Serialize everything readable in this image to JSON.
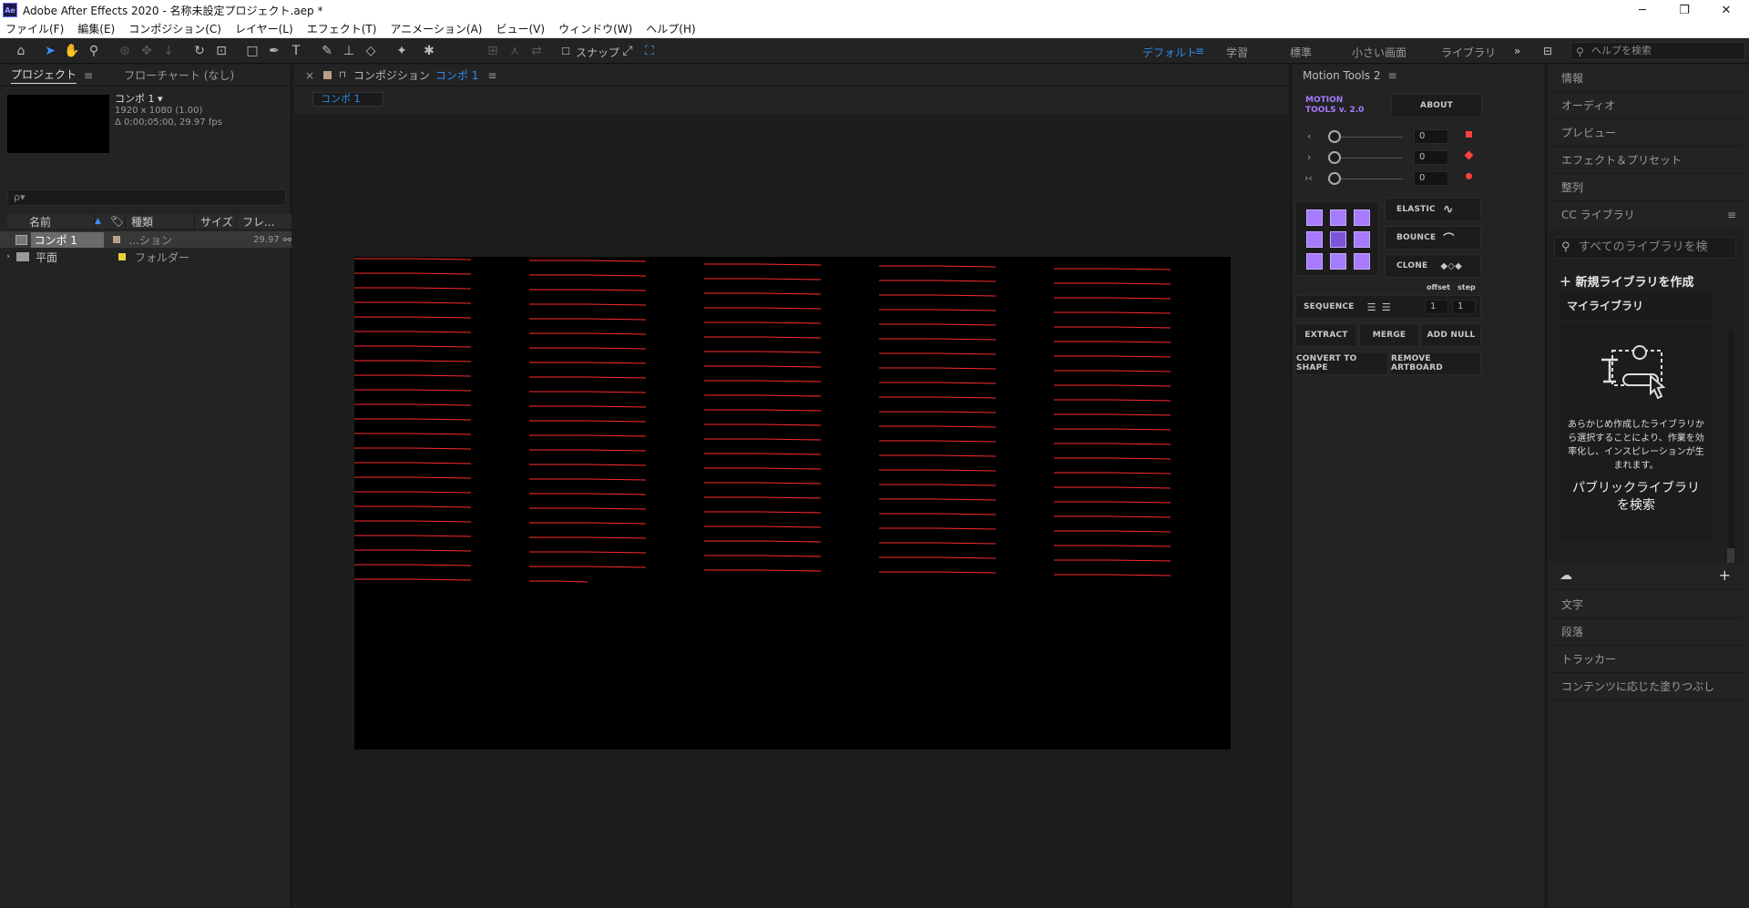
{
  "window": {
    "app_icon": "Ae",
    "title": "Adobe After Effects 2020 - 名称未設定プロジェクト.aep *",
    "controls": {
      "minimize": "─",
      "restore": "❐",
      "close": "✕"
    }
  },
  "menu": [
    "ファイル(F)",
    "編集(E)",
    "コンポジション(C)",
    "レイヤー(L)",
    "エフェクト(T)",
    "アニメーション(A)",
    "ビュー(V)",
    "ウィンドウ(W)",
    "ヘルプ(H)"
  ],
  "toolbar": {
    "snap_label": "スナップ",
    "workspaces": [
      "デフォルト",
      "学習",
      "標準",
      "小さい画面",
      "ライブラリ"
    ],
    "active_workspace": "デフォルト",
    "more": "»",
    "help_placeholder": "ヘルプを検索"
  },
  "project": {
    "tab": "プロジェクト",
    "tab2": "フローチャート (なし)",
    "item_name": "コンポ 1 ▾",
    "item_size": "1920 x 1080 (1.00)",
    "item_duration": "Δ 0;00;05;00, 29.97 fps",
    "search_icon": "ρ▾",
    "columns": [
      "名前",
      "種類",
      "サイズ",
      "フレ..."
    ],
    "rows": [
      {
        "name": "コンポ 1",
        "type": "...ション",
        "fps": "29.97",
        "label_color": "#b8a088"
      },
      {
        "name": "平面",
        "type": "フォルダー",
        "fps": "",
        "label_color": "#e8d23a"
      }
    ]
  },
  "composition": {
    "close": "×",
    "lock_icon": "🔒",
    "title_prefix": "コンポジション",
    "title_name": "コンポ 1",
    "layer_tab": "コンポ 1",
    "background": "#000000",
    "line_color": "#ff2b2b"
  },
  "motion_tools": {
    "panel_title": "Motion Tools 2",
    "logo_line1": "MOTION",
    "logo_line2": "TOOLS v. 2.0",
    "about": "ABOUT",
    "slider_values": [
      "0",
      "0",
      "0"
    ],
    "slider_icons": [
      "‹",
      "›",
      "›‹"
    ],
    "ease_buttons": [
      "ELASTIC",
      "BOUNCE",
      "CLONE"
    ],
    "offset_label": "offset",
    "step_label": "step",
    "sequence": "SEQUENCE",
    "offset_value": "1",
    "step_value": "1",
    "extract": "EXTRACT",
    "merge": "MERGE",
    "add_null": "ADD NULL",
    "convert": "CONVERT TO SHAPE",
    "remove_artboard": "REMOVE ARTBOARD",
    "accent": "#a57bff"
  },
  "right_panel": {
    "top_items": [
      "情報",
      "オーディオ",
      "プレビュー",
      "エフェクト＆プリセット",
      "整列"
    ],
    "cc_title": "CC ライブラリ",
    "cc_search": "すべてのライブラリを検",
    "new_library": "＋ 新規ライブラリを作成",
    "my_library": "マイライブラリ",
    "empty_text": "あらかじめ作成したライブラリから選択することにより、作業を効率化し、インスピレーションが生まれます。",
    "public_search": "パブリックライブラリを検索",
    "bottom_items": [
      "文字",
      "段落",
      "トラッカー",
      "コンテンツに応じた塗りつぶし"
    ]
  }
}
